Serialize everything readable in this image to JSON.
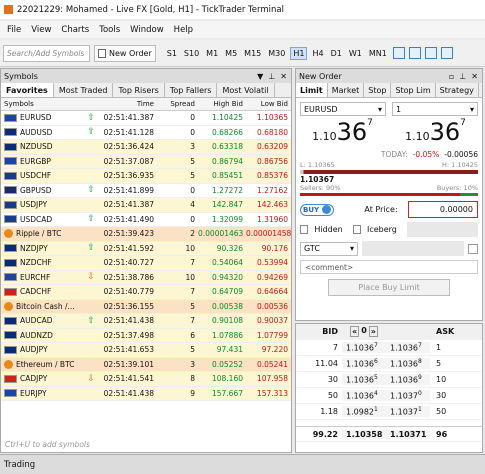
{
  "window": {
    "title": "22021229: Mohamed                   - Live FX [Gold, H1] - TickTrader Terminal"
  },
  "menu": [
    "File",
    "View",
    "Charts",
    "Tools",
    "Window",
    "Help"
  ],
  "toolbar": {
    "search_placeholder": "Search/Add Symbols",
    "new_order": "New Order",
    "timeframes": [
      "S1",
      "S10",
      "M1",
      "M5",
      "M15",
      "M30",
      "H1",
      "H4",
      "D1",
      "W1",
      "MN1"
    ],
    "active_tf": "H1"
  },
  "symbols": {
    "title": "Symbols",
    "tabs": [
      "Favorites",
      "Most Traded",
      "Top Risers",
      "Top Fallers",
      "Most Volatil"
    ],
    "columns": {
      "symbol": "Symbols",
      "time": "Time",
      "spread": "Spread",
      "high": "High Bid",
      "low": "Low Bid"
    },
    "rows": [
      {
        "sym": "EURUSD",
        "time": "02:51:41.387",
        "spread": "0",
        "high": "1.10425",
        "low": "1.10365",
        "dir": "up",
        "bg": "white"
      },
      {
        "sym": "AUDUSD",
        "time": "02:51:41.128",
        "spread": "0",
        "high": "0.68266",
        "low": "0.68180",
        "dir": "up",
        "bg": "white"
      },
      {
        "sym": "NZDUSD",
        "time": "02:51:36.424",
        "spread": "3",
        "high": "0.63318",
        "low": "0.63209",
        "dir": "",
        "bg": "yellow"
      },
      {
        "sym": "EURGBP",
        "time": "02:51:37.087",
        "spread": "5",
        "high": "0.86794",
        "low": "0.86756",
        "dir": "",
        "bg": "yellow"
      },
      {
        "sym": "USDCHF",
        "time": "02:51:36.935",
        "spread": "5",
        "high": "0.85451",
        "low": "0.85376",
        "dir": "",
        "bg": "yellow"
      },
      {
        "sym": "GBPUSD",
        "time": "02:51:41.899",
        "spread": "0",
        "high": "1.27272",
        "low": "1.27162",
        "dir": "up",
        "bg": "white"
      },
      {
        "sym": "USDJPY",
        "time": "02:51:41.387",
        "spread": "4",
        "high": "142.847",
        "low": "142.463",
        "dir": "",
        "bg": "yellow"
      },
      {
        "sym": "USDCAD",
        "time": "02:51:41.490",
        "spread": "0",
        "high": "1.32099",
        "low": "1.31960",
        "dir": "up",
        "bg": "white"
      },
      {
        "sym": "Ripple / BTC",
        "time": "02:51:39.423",
        "spread": "2",
        "high": "0.00001463",
        "low": "0.00001458",
        "dir": "",
        "bg": "orange"
      },
      {
        "sym": "NZDJPY",
        "time": "02:51:41.592",
        "spread": "10",
        "high": "90.326",
        "low": "90.176",
        "dir": "up",
        "bg": "yellow"
      },
      {
        "sym": "NZDCHF",
        "time": "02:51:40.727",
        "spread": "7",
        "high": "0.54064",
        "low": "0.53994",
        "dir": "",
        "bg": "yellow"
      },
      {
        "sym": "EURCHF",
        "time": "02:51:38.786",
        "spread": "10",
        "high": "0.94320",
        "low": "0.94269",
        "dir": "down",
        "bg": "yellow"
      },
      {
        "sym": "CADCHF",
        "time": "02:51:40.779",
        "spread": "7",
        "high": "0.64709",
        "low": "0.64664",
        "dir": "",
        "bg": "yellow"
      },
      {
        "sym": "Bitcoin Cash /...",
        "time": "02:51:36.155",
        "spread": "5",
        "high": "0.00538",
        "low": "0.00536",
        "dir": "",
        "bg": "orange"
      },
      {
        "sym": "AUDCAD",
        "time": "02:51:41.438",
        "spread": "7",
        "high": "0.90108",
        "low": "0.90037",
        "dir": "up",
        "bg": "yellow"
      },
      {
        "sym": "AUDNZD",
        "time": "02:51:37.498",
        "spread": "6",
        "high": "1.07886",
        "low": "1.07799",
        "dir": "",
        "bg": "yellow"
      },
      {
        "sym": "AUDJPY",
        "time": "02:51:41.653",
        "spread": "5",
        "high": "97.431",
        "low": "97.220",
        "dir": "",
        "bg": "yellow"
      },
      {
        "sym": "Ethereum / BTC",
        "time": "02:51:39.101",
        "spread": "3",
        "high": "0.05252",
        "low": "0.05241",
        "dir": "",
        "bg": "orange"
      },
      {
        "sym": "CADJPY",
        "time": "02:51:41.541",
        "spread": "8",
        "high": "108.160",
        "low": "107.958",
        "dir": "down",
        "bg": "yellow"
      },
      {
        "sym": "EURJPY",
        "time": "02:51:41.438",
        "spread": "9",
        "high": "157.667",
        "low": "157.313",
        "dir": "",
        "bg": "yellow"
      }
    ],
    "footer": "Ctrl+U to add symbols"
  },
  "order": {
    "title": "New Order",
    "tabs": [
      "Limit",
      "Market",
      "Stop",
      "Stop Lim",
      "Strategy"
    ],
    "symbol": "EURUSD",
    "qty": "1",
    "sell": {
      "a": "1.10",
      "b": "36",
      "c": "7"
    },
    "buy": {
      "a": "1.10",
      "b": "36",
      "c": "7"
    },
    "today_label": "TODAY:",
    "today_pct": "-0.05%",
    "today_chg": "-0.00056",
    "low": "L: 1.10365",
    "high": "H: 1.10425",
    "price": "1.10367",
    "sellers": "Sellers: 90%",
    "buyers": "Buyers: 10%",
    "buy_toggle": "BUY",
    "at_price_label": "At Price:",
    "at_price": "0.00000",
    "hidden": "Hidden",
    "iceberg": "Iceberg",
    "tif": "GTC",
    "comment_placeholder": "<comment>",
    "place": "Place Buy Limit"
  },
  "dom": {
    "bid": "BID",
    "ask": "ASK",
    "center": "0",
    "rows": [
      {
        "bq": "7",
        "bp": "1.1036",
        "bps": "7",
        "ap": "1.1036",
        "aps": "7",
        "aq": "1"
      },
      {
        "bq": "11.04",
        "bp": "1.1036",
        "bps": "6",
        "ap": "1.1036",
        "aps": "8",
        "aq": "5"
      },
      {
        "bq": "30",
        "bp": "1.1036",
        "bps": "5",
        "ap": "1.1036",
        "aps": "9",
        "aq": "10"
      },
      {
        "bq": "50",
        "bp": "1.1036",
        "bps": "4",
        "ap": "1.1037",
        "aps": "0",
        "aq": "30"
      },
      {
        "bq": "1.18",
        "bp": "1.0982",
        "bps": "1",
        "ap": "1.1037",
        "aps": "1",
        "aq": "50"
      }
    ],
    "tot": {
      "bq": "99.22",
      "bp": "1.10358",
      "ap": "1.10371",
      "aq": "96"
    }
  },
  "bottom": {
    "trading": "Trading"
  }
}
